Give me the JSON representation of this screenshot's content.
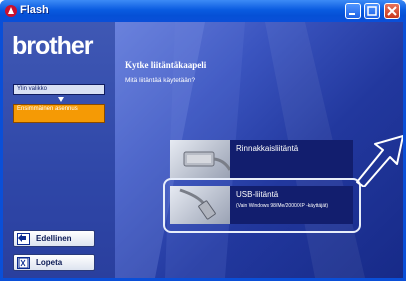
{
  "window": {
    "title": "Flash",
    "buttons": [
      "minimize",
      "maximize",
      "close"
    ]
  },
  "sidebar": {
    "brand": "brother",
    "nav": {
      "main_menu": "Ylin valikko",
      "active_item": "Ensimmäinen asennus"
    },
    "back_button": "Edellinen",
    "exit_button": "Lopeta"
  },
  "main": {
    "title": "Kytke liitäntäkaapeli",
    "subtitle": "Mitä liitäntää käytetään?",
    "options": [
      {
        "label": "Rinnakkaisliitäntä",
        "note": "",
        "icon": "parallel-cable-icon"
      },
      {
        "label": "USB-liitäntä",
        "note": "(Vain Windows 98/Me/2000/XP -käyttäjät)",
        "icon": "usb-cable-icon"
      }
    ]
  },
  "colors": {
    "titlebar": "#0a5be0",
    "sidebar": "#2f47a8",
    "active_nav": "#f59a05",
    "option_bg": "#121e6e"
  }
}
